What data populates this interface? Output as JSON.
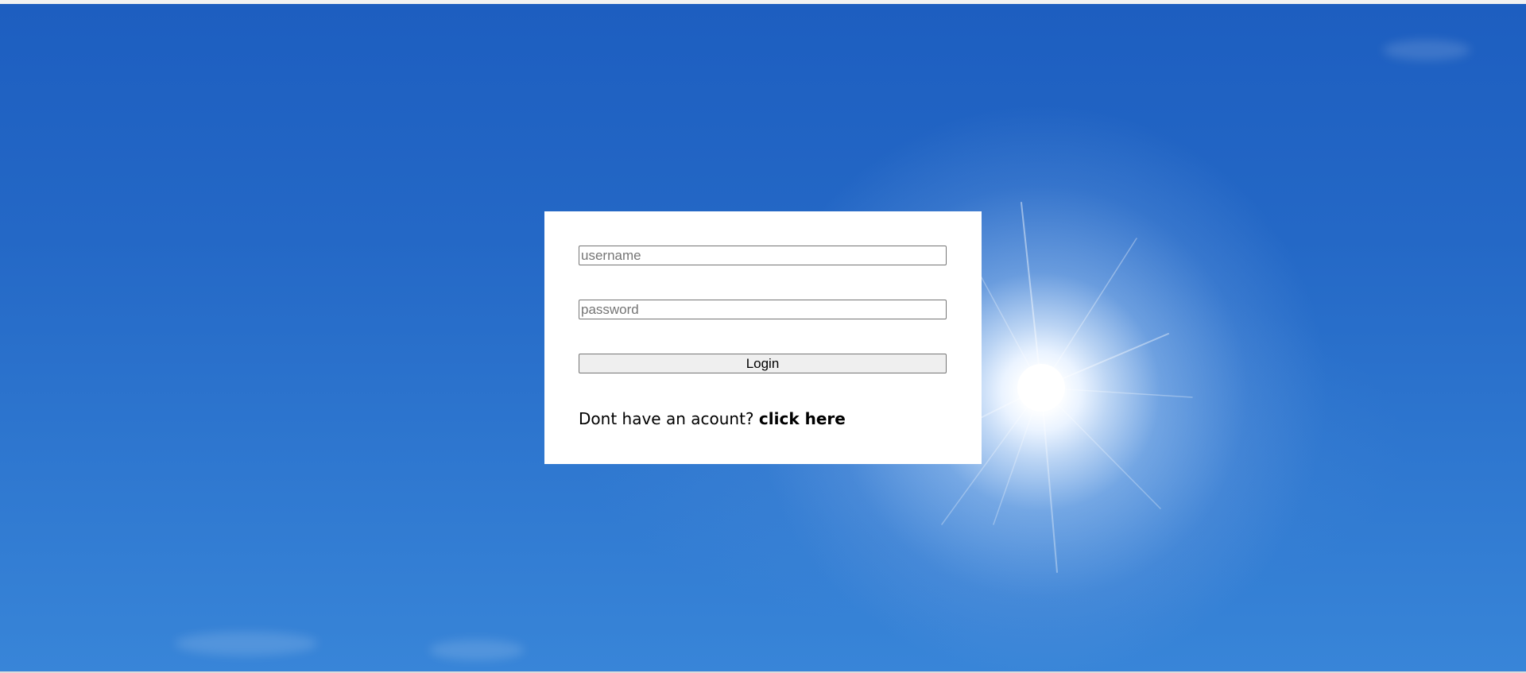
{
  "login": {
    "username_placeholder": "username",
    "password_placeholder": "password",
    "login_button": "Login",
    "signup_prompt": "Dont have an acount?",
    "signup_link": "click here"
  },
  "colors": {
    "sky_top": "#1d5ec0",
    "sky_bottom": "#3885d8",
    "card_background": "#ffffff",
    "button_background": "#efefef"
  }
}
